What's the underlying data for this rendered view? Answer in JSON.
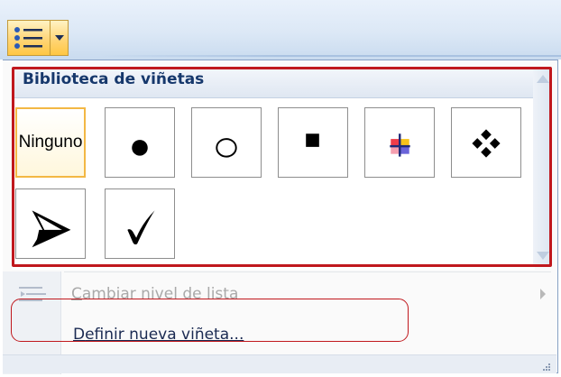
{
  "ribbon": {
    "bullet_button_icon": "bullet-list-icon",
    "dropdown_icon": "chevron-down-icon"
  },
  "gallery": {
    "title": "Biblioteca de viñetas",
    "tiles": [
      {
        "id": "none",
        "label": "Ninguno",
        "selected": true
      },
      {
        "id": "filled-circle",
        "icon": "filled-circle-bullet-icon"
      },
      {
        "id": "hollow-circle",
        "icon": "hollow-circle-bullet-icon"
      },
      {
        "id": "filled-square",
        "icon": "filled-square-bullet-icon"
      },
      {
        "id": "color-cross",
        "icon": "color-cross-bullet-icon"
      },
      {
        "id": "four-diamonds",
        "icon": "four-diamonds-bullet-icon"
      },
      {
        "id": "arrowhead",
        "icon": "arrowhead-bullet-icon"
      },
      {
        "id": "checkmark",
        "icon": "checkmark-bullet-icon"
      }
    ]
  },
  "menu": {
    "change_level": {
      "label": "Cambiar nivel de lista",
      "accelerator": "C",
      "enabled": false
    },
    "define_bullet": {
      "label": "Definir nueva viñeta...",
      "accelerator": "D",
      "enabled": true
    }
  },
  "colors": {
    "highlight": "#c0181d",
    "selected_tile_border": "#f3b844",
    "header_text": "#16386c"
  }
}
